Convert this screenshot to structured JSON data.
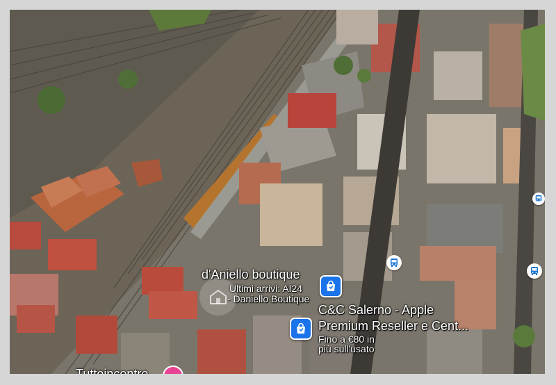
{
  "map": {
    "pois": [
      {
        "title": "d'Aniello boutique",
        "subtitle_line1": "Ultimi arrivi: AI24",
        "subtitle_line2": "- Daniello Boutique"
      },
      {
        "title_line1": "C&C Salerno - Apple",
        "title_line2": "Premium Reseller e Cent...",
        "subtitle_line1": "Fino a €80 in",
        "subtitle_line2": "più sull'usato"
      }
    ],
    "bottom_label": "Tuttoincentro",
    "icons": {
      "shopping": "shopping-bag-icon",
      "transit": "bus-icon",
      "store": "storefront-icon"
    },
    "colors": {
      "pin": "#1a73e8",
      "pink_pin": "#e84393"
    }
  }
}
